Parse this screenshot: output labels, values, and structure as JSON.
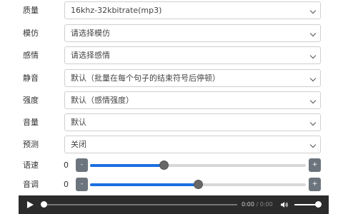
{
  "form": {
    "quality": {
      "label": "质量",
      "value": "16khz-32kbitrate(mp3)"
    },
    "imitate": {
      "label": "模仿",
      "value": "请选择模仿"
    },
    "emotion": {
      "label": "感情",
      "value": "请选择感情"
    },
    "silence": {
      "label": "静音",
      "value": "默认（批量在每个句子的结束符号后停顿）"
    },
    "intensity": {
      "label": "强度",
      "value": "默认（感情强度）"
    },
    "volume": {
      "label": "音量",
      "value": "默认"
    },
    "predict": {
      "label": "预测",
      "value": "关闭"
    },
    "speed": {
      "label": "语速",
      "value": "0",
      "minus": "-",
      "plus": "+",
      "level": 0.34
    },
    "pitch": {
      "label": "音调",
      "value": "0",
      "minus": "-",
      "plus": "+",
      "level": 0.5
    }
  },
  "player": {
    "current_time": "0:00",
    "separator": "/",
    "duration": "0:00",
    "progress": 0,
    "volume_level": 0.85
  },
  "icons": {
    "play": "play-icon",
    "volume": "volume-icon",
    "dropdown": "chevron-down-icon"
  }
}
